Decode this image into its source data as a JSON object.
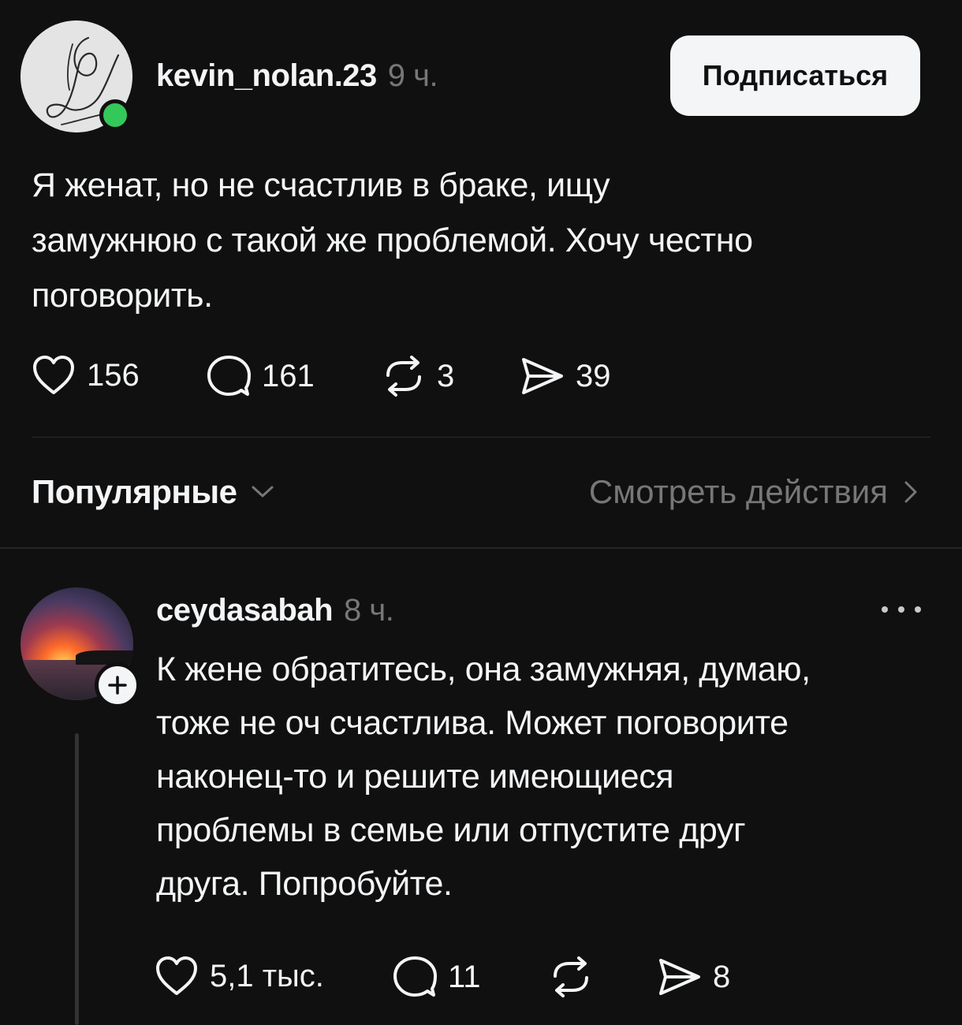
{
  "post": {
    "username": "kevin_nolan.23",
    "time_ago": "9 ч.",
    "subscribe_label": "Подписаться",
    "text_lines": [
      "Я женат, но не счастлив в браке, ищу",
      "замужнюю с такой же проблемой. Хочу честно",
      "поговорить."
    ],
    "actions": {
      "likes": "156",
      "comments": "161",
      "reposts": "3",
      "shares": "39"
    },
    "online": true
  },
  "replies_header": {
    "sort_label": "Популярные",
    "view_activity_label": "Смотреть действия"
  },
  "reply": {
    "username": "ceydasabah",
    "time_ago": "8 ч.",
    "text_lines": [
      "К жене обратитесь, она замужняя, думаю,",
      "тоже не оч счастлива. Может поговорите",
      "наконец-то и решите имеющиеся",
      "проблемы в семье или отпустите друг",
      "друга. Попробуйте."
    ],
    "actions": {
      "likes": "5,1 тыс.",
      "comments": "11",
      "shares": "8"
    }
  },
  "icons": {
    "like": "heart-icon",
    "comment": "comment-bubble-icon",
    "repost": "repost-icon",
    "share": "send-icon",
    "sort": "chevron-down-icon",
    "view": "chevron-right-icon",
    "more": "more-icon",
    "follow": "plus-icon"
  },
  "colors": {
    "background": "#101010",
    "text": "#f3f5f7",
    "muted": "#777777",
    "online": "#34c759",
    "button_bg": "#f3f5f7"
  }
}
